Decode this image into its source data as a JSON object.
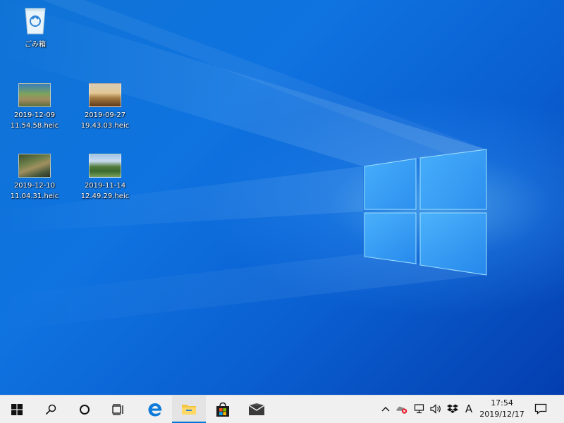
{
  "desktop": {
    "icons": [
      {
        "label": "ごみ箱",
        "icon": "recycle-bin-icon"
      },
      {
        "label_line1": "2019-12-09",
        "label_line2": "11.54.58.heic"
      },
      {
        "label_line1": "2019-09-27",
        "label_line2": "19.43.03.heic"
      },
      {
        "label_line1": "2019-12-10",
        "label_line2": "11.04.31.heic"
      },
      {
        "label_line1": "2019-11-14",
        "label_line2": "12.49.29.heic"
      }
    ]
  },
  "taskbar": {
    "buttons": [
      {
        "name": "start",
        "icon": "windows-logo-icon"
      },
      {
        "name": "search",
        "icon": "search-icon"
      },
      {
        "name": "cortana",
        "icon": "circle-icon"
      },
      {
        "name": "task-view",
        "icon": "task-view-icon"
      },
      {
        "name": "edge",
        "icon": "edge-icon"
      },
      {
        "name": "file-explorer",
        "icon": "folder-icon",
        "active": true
      },
      {
        "name": "store",
        "icon": "store-bag-icon"
      },
      {
        "name": "mail",
        "icon": "mail-icon"
      }
    ],
    "tray": {
      "icons": [
        "chevron-up-icon",
        "onedrive-error-icon",
        "network-icon",
        "volume-icon",
        "dropbox-icon"
      ],
      "ime": "A",
      "time": "17:54",
      "date": "2019/12/17"
    }
  },
  "colors": {
    "accent": "#0078d7",
    "desktop_base": "#0a64d4",
    "taskbar": "#f0f0f0"
  }
}
